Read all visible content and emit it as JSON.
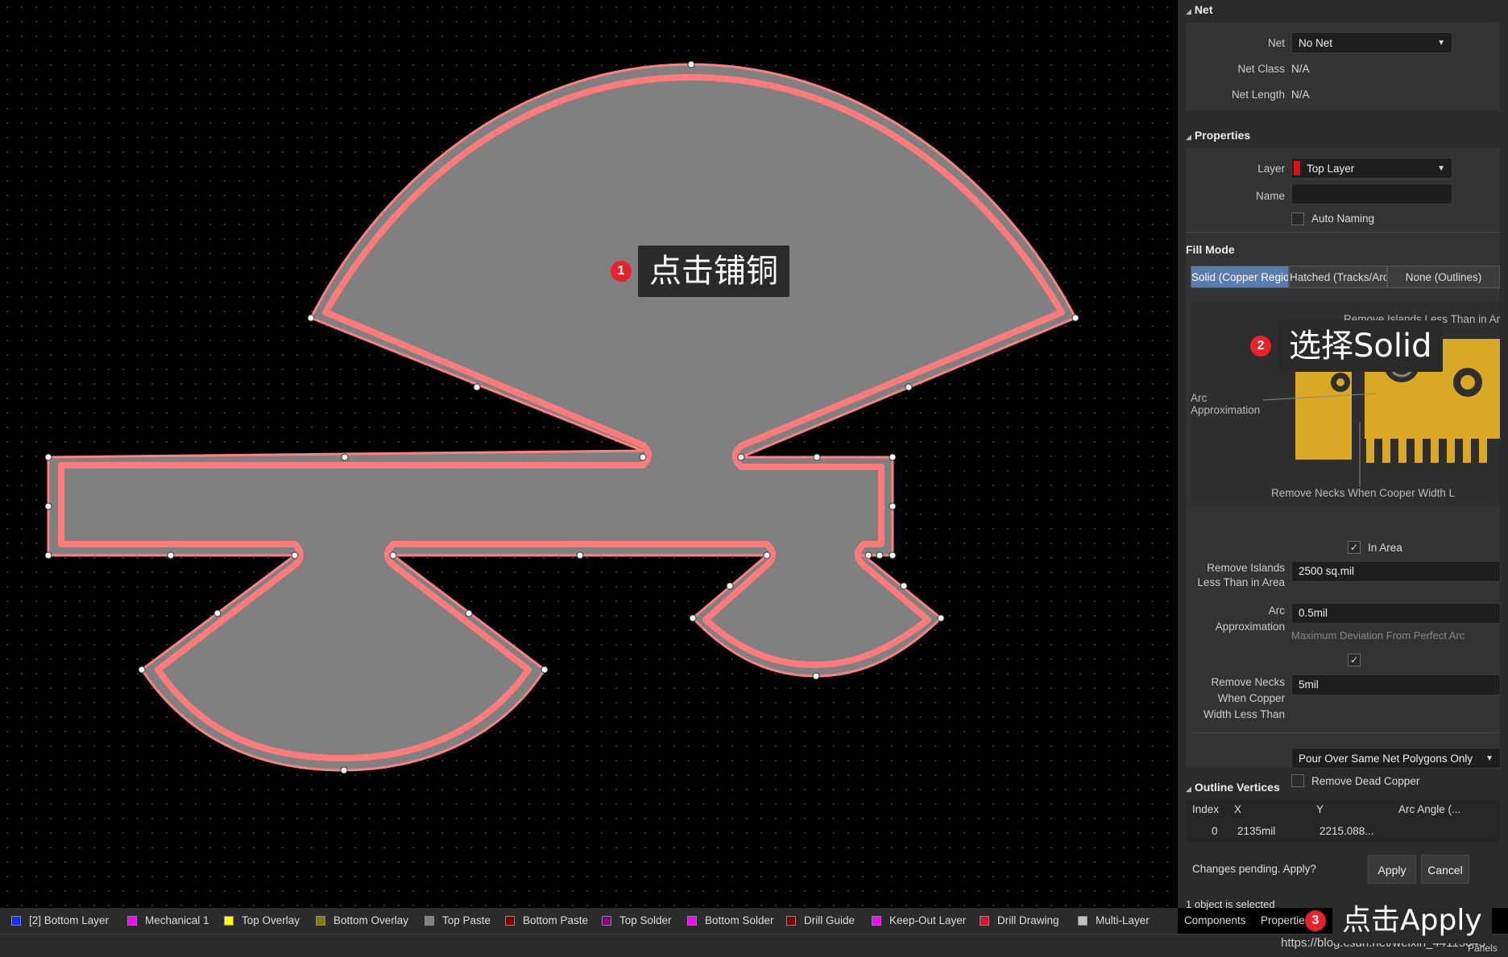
{
  "canvas": {
    "callouts": [
      {
        "num": "1",
        "text": "点击铺铜"
      },
      {
        "num": "2",
        "text": "选择Solid"
      },
      {
        "num": "3",
        "text": "点击Apply"
      }
    ]
  },
  "panel": {
    "net_section": {
      "title": "Net",
      "net_label": "Net",
      "net_value": "No Net",
      "netclass_label": "Net Class",
      "netclass_value": "N/A",
      "netlength_label": "Net Length",
      "netlength_value": "N/A"
    },
    "properties_section": {
      "title": "Properties",
      "layer_label": "Layer",
      "layer_value": "Top Layer",
      "layer_color": "#e01010",
      "name_label": "Name",
      "name_value": "",
      "auto_naming_label": "Auto Naming"
    },
    "fill_mode": {
      "title": "Fill Mode",
      "options": [
        "Solid (Copper Regions)",
        "Hatched (Tracks/Arcs)",
        "None (Outlines)"
      ],
      "selected": "Solid (Copper Regions)",
      "diagram_text_islands": "Remove Islands Less Than in Area",
      "diagram_text_arc": "Arc Approximation",
      "diagram_text_necks": "Remove Necks When Cooper Width L"
    },
    "options": {
      "in_area_label": "In Area",
      "in_area_checked": true,
      "remove_islands_label_1": "Remove Islands",
      "remove_islands_label_2": "Less Than in Area",
      "remove_islands_value": "2500 sq.mil",
      "arc_label_1": "Arc",
      "arc_label_2": "Approximation",
      "arc_value": "0.5mil",
      "arc_hint": "Maximum Deviation From Perfect Arc",
      "necks_checked": true,
      "necks_label_1": "Remove Necks",
      "necks_label_2": "When Copper",
      "necks_label_3": "Width Less Than",
      "necks_value": "5mil",
      "pour_over_value": "Pour Over Same Net Polygons Only",
      "remove_dead_label": "Remove Dead Copper",
      "remove_dead_checked": false
    },
    "outline_vertices": {
      "title": "Outline Vertices",
      "columns": [
        "Index",
        "X",
        "Y",
        "Arc Angle (..."
      ],
      "rows": [
        [
          "0",
          "2135mil",
          "2215.088...",
          ""
        ]
      ]
    },
    "pending_text": "Changes pending. Apply?",
    "apply_label": "Apply",
    "cancel_label": "Cancel",
    "selection_status": "1 object is selected"
  },
  "layers": [
    {
      "name": "[2] Bottom Layer",
      "color": "#1a2cff"
    },
    {
      "name": "Mechanical 1",
      "color": "#ff00ff"
    },
    {
      "name": "Top Overlay",
      "color": "#ffff00"
    },
    {
      "name": "Bottom Overlay",
      "color": "#808000"
    },
    {
      "name": "Top Paste",
      "color": "#808080"
    },
    {
      "name": "Bottom Paste",
      "color": "#800000"
    },
    {
      "name": "Top Solder",
      "color": "#800080"
    },
    {
      "name": "Bottom Solder",
      "color": "#ff00ff"
    },
    {
      "name": "Drill Guide",
      "color": "#800000"
    },
    {
      "name": "Keep-Out Layer",
      "color": "#ff00ff"
    },
    {
      "name": "Drill Drawing",
      "color": "#e01030"
    },
    {
      "name": "Multi-Layer",
      "color": "#c0c0c0"
    }
  ],
  "bottom_tabs": {
    "components": "Components",
    "properties": "Properties",
    "panels": "Panels"
  },
  "watermark": "https://blog.csdn.net/weixin_44115643"
}
